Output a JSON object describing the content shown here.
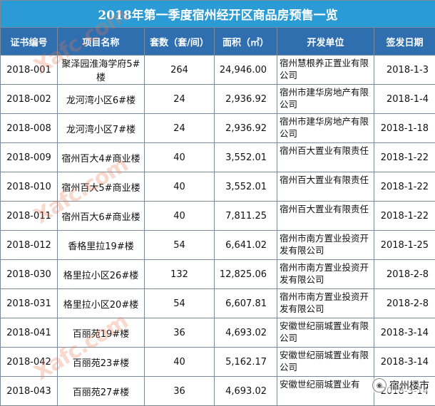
{
  "title": "2018年第一季度宿州经开区商品房预售一览",
  "headers": [
    "证书编号",
    "项目名称",
    "套数（套/间）",
    "面积（㎡）",
    "开发单位",
    "签发日期"
  ],
  "rows": [
    {
      "cert": "2018-001",
      "name": "聚泽园淮海学府5#楼",
      "count": "264",
      "area": "24,946.00",
      "dev": "宿州慧根养正置业有限公司",
      "date": "2018-1-3"
    },
    {
      "cert": "2018-002",
      "name": "龙河湾小区6#楼",
      "count": "24",
      "area": "2,936.92",
      "dev": "宿州市建华房地产有限公司",
      "date": "2018-1-4"
    },
    {
      "cert": "2018-008",
      "name": "龙河湾小区7#楼",
      "count": "24",
      "area": "2,936.92",
      "dev": "宿州市建华房地产有限公司",
      "date": "2018-1-18"
    },
    {
      "cert": "2018-009",
      "name": "宿州百大4#商业楼",
      "count": "40",
      "area": "3,552.01",
      "dev": "宿州百大置业有限责任",
      "date": "2018-1-22"
    },
    {
      "cert": "2018-010",
      "name": "宿州百大5#商业楼",
      "count": "40",
      "area": "3,552.01",
      "dev": "宿州百大置业有限责任",
      "date": "2018-1-22"
    },
    {
      "cert": "2018-011",
      "name": "宿州百大6#商业楼",
      "count": "40",
      "area": "7,811.25",
      "dev": "宿州百大置业有限责任",
      "date": "2018-1-22"
    },
    {
      "cert": "2018-012",
      "name": "香格里拉19#楼",
      "count": "54",
      "area": "6,641.02",
      "dev": "宿州市南方置业投资开发有限公司",
      "date": "2018-1-25"
    },
    {
      "cert": "2018-030",
      "name": "格里拉小区26#楼",
      "count": "132",
      "area": "12,825.06",
      "dev": "宿州市南方置业投资开发有限公司",
      "date": "2018-2-8"
    },
    {
      "cert": "2018-031",
      "name": "格里拉小区20#楼",
      "count": "54",
      "area": "6,607.81",
      "dev": "宿州市南方置业投资开发有限公司",
      "date": "2018-2-8"
    },
    {
      "cert": "2018-041",
      "name": "百丽苑19#楼",
      "count": "36",
      "area": "4,693.02",
      "dev": "安徽世纪丽城置业有限公司",
      "date": "2018-3-14"
    },
    {
      "cert": "2018-042",
      "name": "百丽苑23#楼",
      "count": "40",
      "area": "5,162.17",
      "dev": "安徽世纪丽城置业有限公司",
      "date": "2018-3-14"
    },
    {
      "cert": "2018-043",
      "name": "百丽苑27#楼",
      "count": "36",
      "area": "4,693.02",
      "dev": "安徽世纪丽城置业有",
      "date": "2018-3-14"
    }
  ],
  "watermark": {
    "text": "Xafc.com",
    "logo_text": "宿州楼市"
  }
}
